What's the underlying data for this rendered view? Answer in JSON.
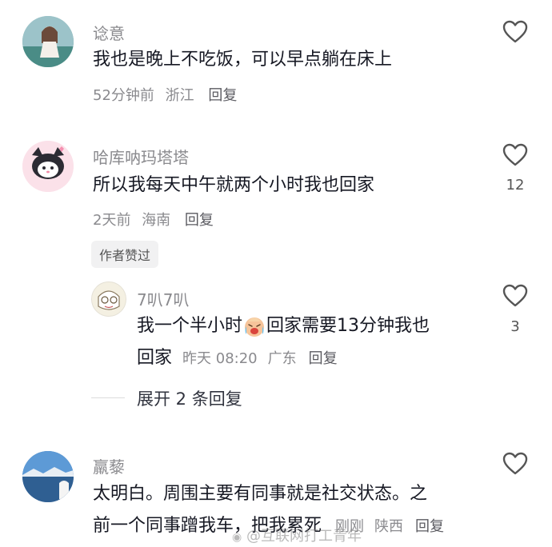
{
  "comments": [
    {
      "username": "谂意",
      "text": "我也是晚上不吃饭，可以早点躺在床上",
      "time": "52分钟前",
      "location": "浙江",
      "reply_label": "回复",
      "like_count": ""
    },
    {
      "username": "哈库呐玛塔塔",
      "text": "所以我每天中午就两个小时我也回家",
      "time": "2天前",
      "location": "海南",
      "reply_label": "回复",
      "like_count": "12",
      "badge": "作者赞过",
      "replies": [
        {
          "username": "7叭7叭",
          "text_before_emoji": "我一个半小时",
          "emoji": "crying-laughing-emoji",
          "text_after_emoji": "回家需要13分钟我也",
          "text_line2": "回家",
          "time": "昨天 08:20",
          "location": "广东",
          "reply_label": "回复",
          "like_count": "3"
        }
      ],
      "expand_label": "展开 2 条回复"
    },
    {
      "username": "羸藜",
      "text_line1": "太明白。周围主要有同事就是社交状态。之",
      "text_line2": "前一个同事蹭我车，把我累死",
      "time": "刚刚",
      "location": "陕西",
      "reply_label": "回复",
      "like_count": ""
    }
  ],
  "watermark": "@互联网打工青年",
  "colors": {
    "text": "#161823",
    "meta": "#8a8a8e",
    "badge_bg": "#f1f1f2"
  }
}
